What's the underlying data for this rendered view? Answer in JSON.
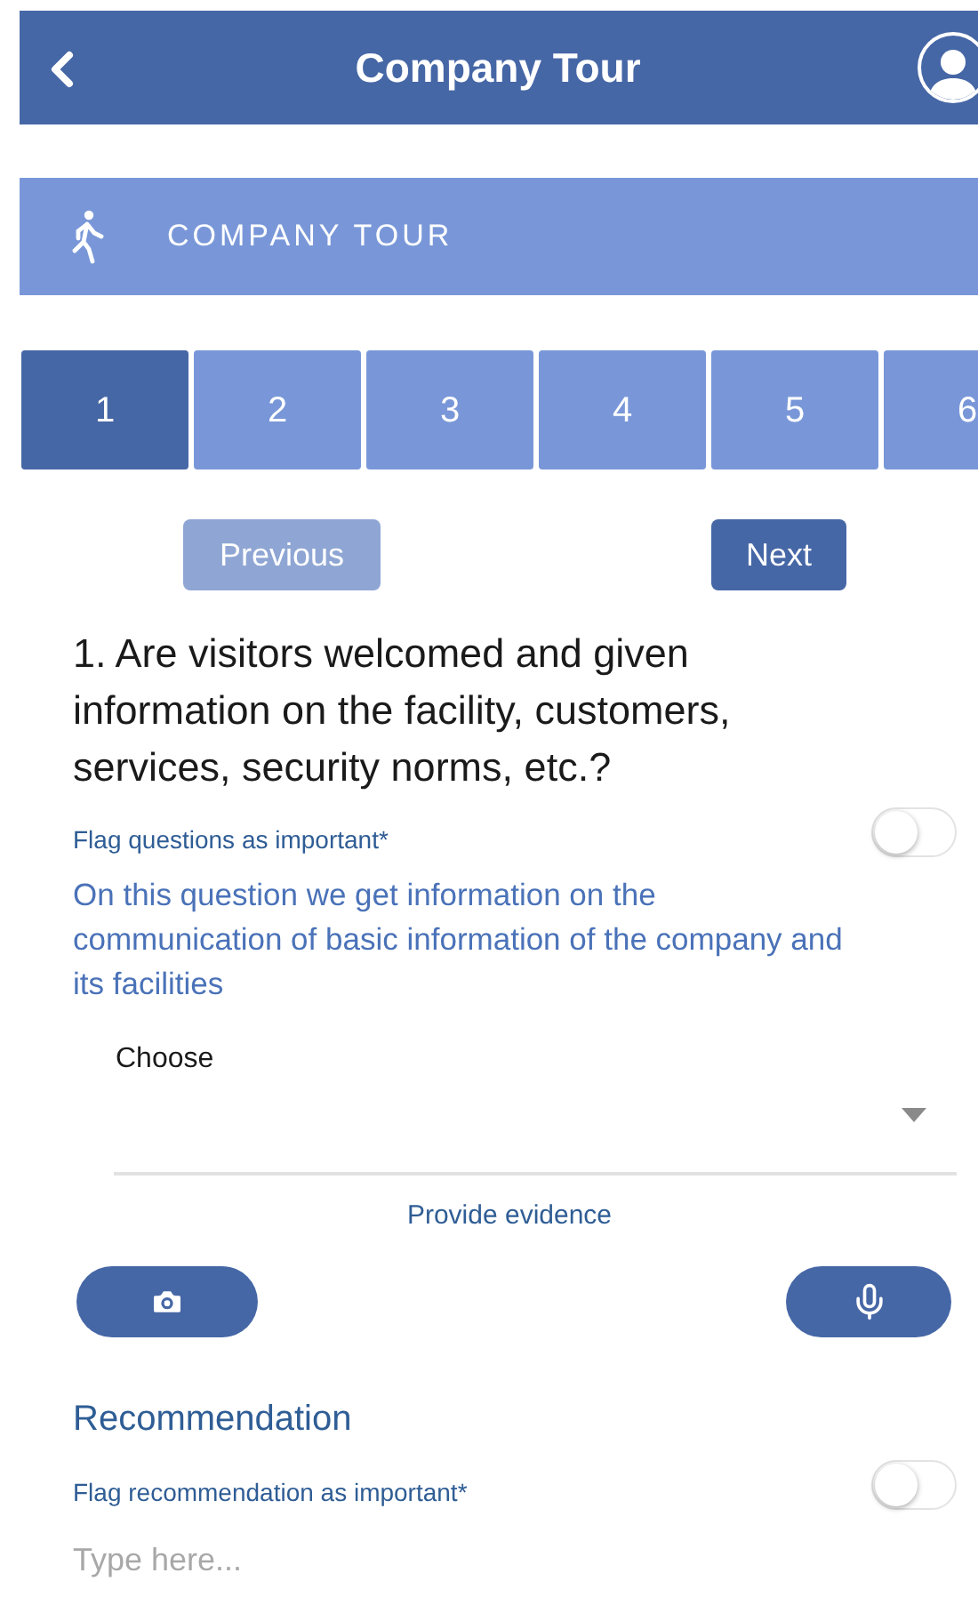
{
  "header": {
    "title": "Company Tour"
  },
  "banner": {
    "title": "COMPANY TOUR"
  },
  "steps": [
    {
      "label": "1",
      "selected": true
    },
    {
      "label": "2",
      "selected": false
    },
    {
      "label": "3",
      "selected": false
    },
    {
      "label": "4",
      "selected": false
    },
    {
      "label": "5",
      "selected": false
    },
    {
      "label": "6",
      "selected": false
    }
  ],
  "nav": {
    "previous": {
      "label": "Previous",
      "disabled": true
    },
    "next": {
      "label": "Next",
      "disabled": false
    }
  },
  "question": {
    "text": "1. Are visitors welcomed and given information on the facility, customers, services, security norms, etc.?",
    "flag_label": "Flag questions as important*",
    "flag_on": false,
    "description": "On this question we get information on the communication of basic information of the company and its facilities",
    "select_label": "Choose",
    "evidence_label": "Provide evidence"
  },
  "recommendation": {
    "title": "Recommendation",
    "flag_label": "Flag recommendation as important*",
    "flag_on": false,
    "placeholder": "Type here..."
  }
}
